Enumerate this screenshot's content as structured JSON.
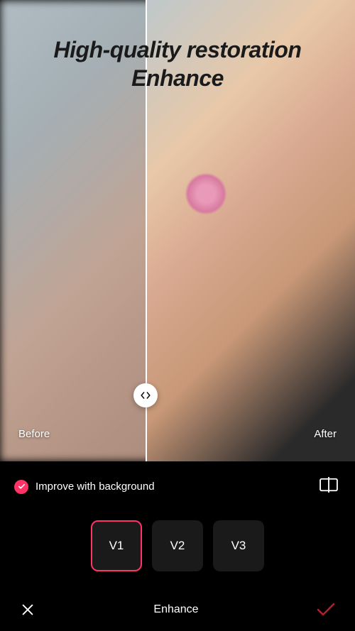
{
  "headline": {
    "line1": "High-quality restoration",
    "line2": "Enhance"
  },
  "preview": {
    "before_label": "Before",
    "after_label": "After",
    "divider_position_percent": 41
  },
  "options": {
    "bg_toggle_label": "Improve with background",
    "bg_toggle_checked": true
  },
  "versions": [
    {
      "label": "V1",
      "active": true
    },
    {
      "label": "V2",
      "active": false
    },
    {
      "label": "V3",
      "active": false
    }
  ],
  "footer": {
    "title": "Enhance"
  },
  "colors": {
    "accent": "#ff3366",
    "confirm": "#b4202a"
  }
}
